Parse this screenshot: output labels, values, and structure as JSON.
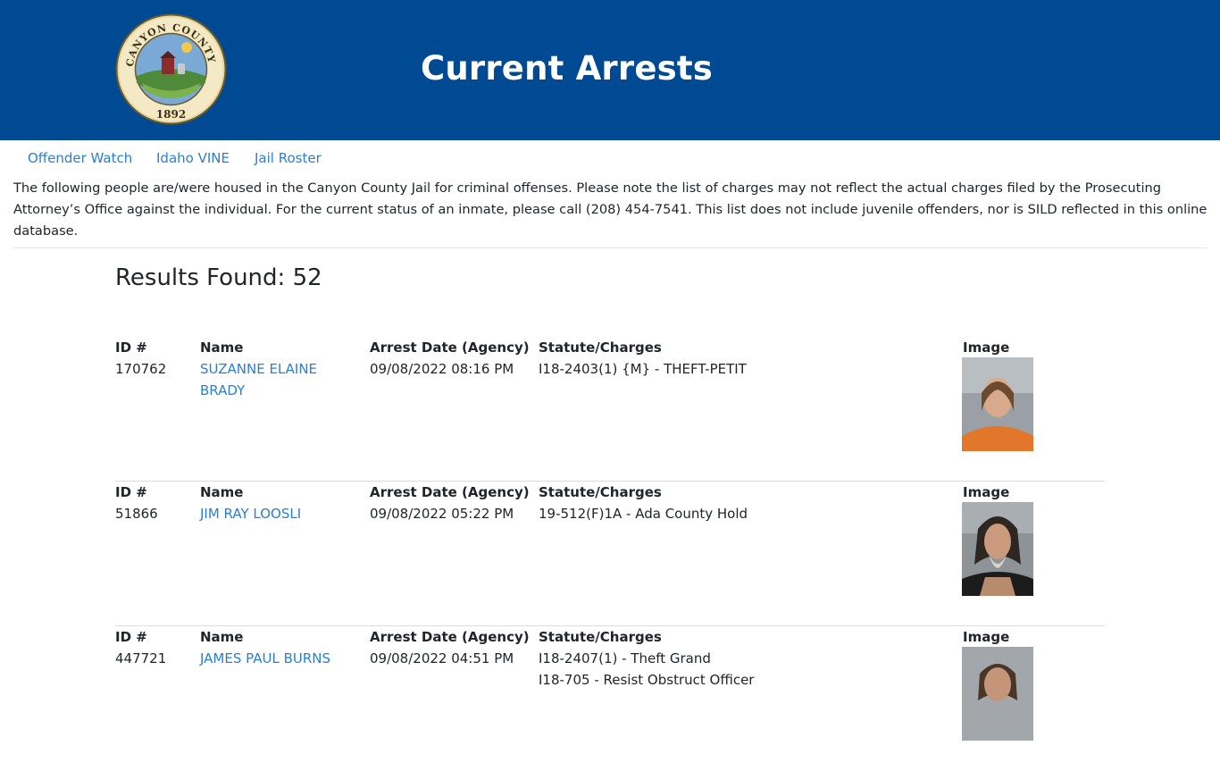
{
  "header": {
    "seal_text_top": "CANYON COUNTY IDAHO",
    "seal_year": "1892",
    "title": "Current Arrests"
  },
  "nav": [
    {
      "label": "Offender Watch"
    },
    {
      "label": "Idaho VINE"
    },
    {
      "label": "Jail Roster"
    }
  ],
  "intro": "The following people are/were housed in the Canyon County Jail for criminal offenses. Please note the list of charges may not reflect the actual charges filed by the Prosecuting Attorney’s Office against the individual. For the current status of an inmate, please call (208) 454-7541. This list does not include juvenile offenders, nor is SILD reflected in this online database.",
  "results_label": "Results Found: 52",
  "columns": {
    "id": "ID #",
    "name": "Name",
    "date": "Arrest Date (Agency)",
    "charges": "Statute/Charges",
    "image": "Image"
  },
  "records": [
    {
      "id": "170762",
      "name_line1": "SUZANNE ELAINE",
      "name_line2": "BRADY",
      "arrest_date": "09/08/2022 08:16 PM",
      "charges": [
        "I18-2403(1) {M} - THEFT-PETIT"
      ],
      "photo_shirt_color": "#e2772c"
    },
    {
      "id": "51866",
      "name_line1": "JIM RAY LOOSLI",
      "name_line2": "",
      "arrest_date": "09/08/2022 05:22 PM",
      "charges": [
        "19-512(F)1A - Ada County Hold"
      ],
      "photo_shirt_color": "#1c1c1c"
    },
    {
      "id": "447721",
      "name_line1": "JAMES PAUL BURNS",
      "name_line2": "",
      "arrest_date": "09/08/2022 04:51 PM",
      "charges": [
        "I18-2407(1) - Theft Grand",
        "I18-705 - Resist Obstruct Officer"
      ],
      "photo_shirt_color": "#555555"
    }
  ],
  "colors": {
    "header_bg": "#004a93",
    "link": "#2a7fd4"
  }
}
